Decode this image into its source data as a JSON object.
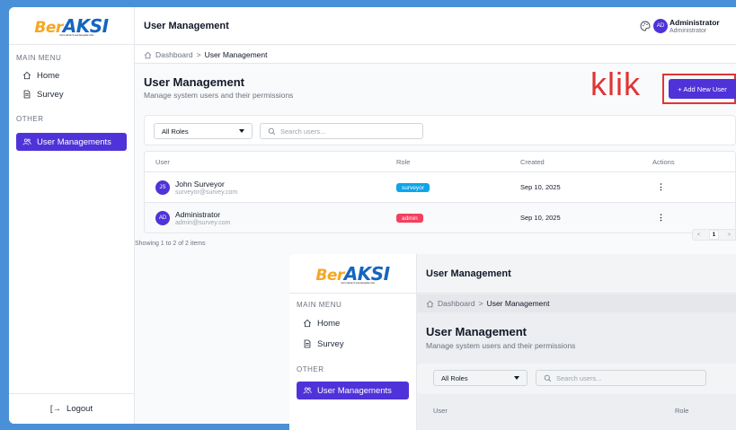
{
  "brand": {
    "prefix": "Ber",
    "name": "AKSI",
    "tagline": "Kemudahan Survei, Kecepatan Aksi"
  },
  "sidebar": {
    "main_menu_label": "MAIN MENU",
    "other_label": "OTHER",
    "items": [
      {
        "label": "Home",
        "icon": "home-icon"
      },
      {
        "label": "Survey",
        "icon": "document-icon"
      },
      {
        "label": "User Managements",
        "icon": "users-icon",
        "active": true
      }
    ],
    "logout_label": "Logout"
  },
  "header": {
    "title": "User Management",
    "avatar_initials": "AD",
    "user_name": "Administrator",
    "user_role": "Administrator"
  },
  "breadcrumb": {
    "root": "Dashboard",
    "separator": ">",
    "current": "User Management"
  },
  "page": {
    "title": "User Management",
    "subtitle": "Manage system users and their permissions",
    "add_button_label": "+ Add New User"
  },
  "annotation": {
    "text": "klik",
    "color": "#e03535"
  },
  "filters": {
    "role_selected": "All Roles",
    "search_placeholder": "Search users..."
  },
  "table": {
    "headers": [
      "User",
      "Role",
      "Created",
      "Actions"
    ],
    "rows": [
      {
        "initials": "JS",
        "name": "John Surveyor",
        "email": "surveyor@survey.com",
        "role": "surveyor",
        "role_color": "#0ea5e9",
        "created": "Sep 10, 2025",
        "actions": "⋮"
      },
      {
        "initials": "AD",
        "name": "Administrator",
        "email": "admin@survey.com",
        "role": "admin",
        "role_color": "#f43f5e",
        "created": "Sep 10, 2025",
        "actions": "⋮"
      }
    ],
    "showing": "Showing 1 to 2 of 2 items",
    "pager": {
      "prev": "<",
      "current": "1",
      "next": ">"
    }
  },
  "colors": {
    "accent": "#4f33d9",
    "background": "#4a90d9"
  }
}
